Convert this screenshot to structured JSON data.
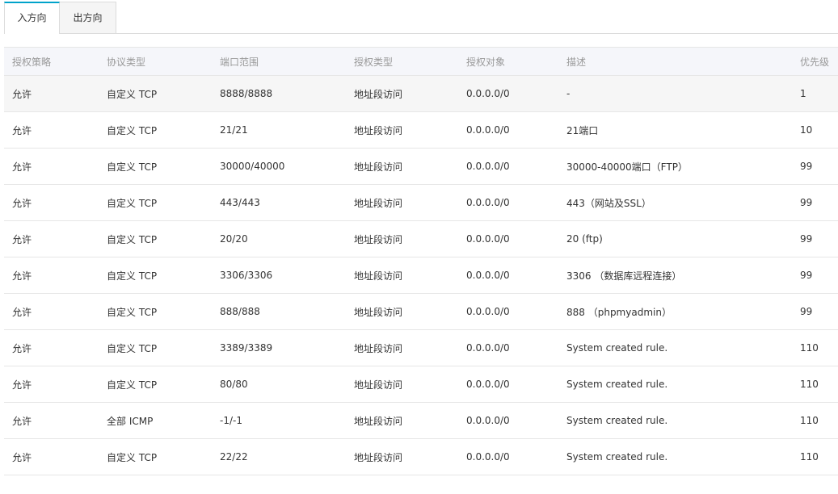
{
  "tabs": {
    "inbound": "入方向",
    "outbound": "出方向"
  },
  "table": {
    "headers": {
      "policy": "授权策略",
      "protocol": "协议类型",
      "port_range": "端口范围",
      "auth_type": "授权类型",
      "auth_object": "授权对象",
      "description": "描述",
      "priority": "优先级"
    },
    "rows": [
      {
        "policy": "允许",
        "protocol": "自定义 TCP",
        "port_range": "8888/8888",
        "auth_type": "地址段访问",
        "auth_object": "0.0.0.0/0",
        "description": "-",
        "priority": "1"
      },
      {
        "policy": "允许",
        "protocol": "自定义 TCP",
        "port_range": "21/21",
        "auth_type": "地址段访问",
        "auth_object": "0.0.0.0/0",
        "description": "21端口",
        "priority": "10"
      },
      {
        "policy": "允许",
        "protocol": "自定义 TCP",
        "port_range": "30000/40000",
        "auth_type": "地址段访问",
        "auth_object": "0.0.0.0/0",
        "description": "30000-40000端口（FTP）",
        "priority": "99"
      },
      {
        "policy": "允许",
        "protocol": "自定义 TCP",
        "port_range": "443/443",
        "auth_type": "地址段访问",
        "auth_object": "0.0.0.0/0",
        "description": "443（网站及SSL）",
        "priority": "99"
      },
      {
        "policy": "允许",
        "protocol": "自定义 TCP",
        "port_range": "20/20",
        "auth_type": "地址段访问",
        "auth_object": "0.0.0.0/0",
        "description": "20 (ftp)",
        "priority": "99"
      },
      {
        "policy": "允许",
        "protocol": "自定义 TCP",
        "port_range": "3306/3306",
        "auth_type": "地址段访问",
        "auth_object": "0.0.0.0/0",
        "description": "3306 （数据库远程连接）",
        "priority": "99"
      },
      {
        "policy": "允许",
        "protocol": "自定义 TCP",
        "port_range": "888/888",
        "auth_type": "地址段访问",
        "auth_object": "0.0.0.0/0",
        "description": "888 （phpmyadmin）",
        "priority": "99"
      },
      {
        "policy": "允许",
        "protocol": "自定义 TCP",
        "port_range": "3389/3389",
        "auth_type": "地址段访问",
        "auth_object": "0.0.0.0/0",
        "description": "System created rule.",
        "priority": "110"
      },
      {
        "policy": "允许",
        "protocol": "自定义 TCP",
        "port_range": "80/80",
        "auth_type": "地址段访问",
        "auth_object": "0.0.0.0/0",
        "description": "System created rule.",
        "priority": "110"
      },
      {
        "policy": "允许",
        "protocol": "全部 ICMP",
        "port_range": "-1/-1",
        "auth_type": "地址段访问",
        "auth_object": "0.0.0.0/0",
        "description": "System created rule.",
        "priority": "110"
      },
      {
        "policy": "允许",
        "protocol": "自定义 TCP",
        "port_range": "22/22",
        "auth_type": "地址段访问",
        "auth_object": "0.0.0.0/0",
        "description": "System created rule.",
        "priority": "110"
      }
    ]
  }
}
